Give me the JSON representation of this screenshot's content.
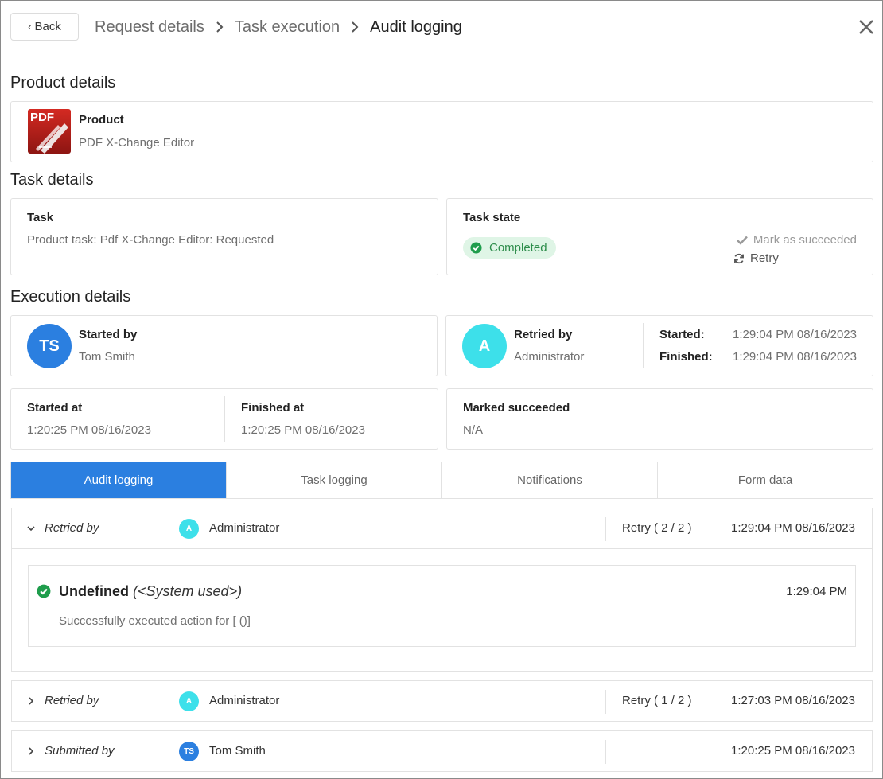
{
  "header": {
    "back_label": "Back",
    "breadcrumbs": [
      "Request details",
      "Task execution",
      "Audit logging"
    ]
  },
  "product_section": {
    "title": "Product details",
    "product_label": "Product",
    "product_name": "PDF X-Change Editor",
    "logo_text": "PDF"
  },
  "task_section": {
    "title": "Task details",
    "task_label": "Task",
    "task_value": "Product task: Pdf X-Change Editor: Requested",
    "state_label": "Task state",
    "state_value": "Completed",
    "mark_succeeded_label": "Mark as succeeded",
    "retry_label": "Retry"
  },
  "execution_section": {
    "title": "Execution details",
    "started_by_label": "Started by",
    "started_by_name": "Tom Smith",
    "started_by_initials": "TS",
    "retried_by_label": "Retried by",
    "retried_by_name": "Administrator",
    "retried_by_initials": "A",
    "started_label": "Started:",
    "started_value": "1:29:04 PM 08/16/2023",
    "finished_label": "Finished:",
    "finished_value": "1:29:04 PM 08/16/2023",
    "started_at_label": "Started at",
    "started_at_value": "1:20:25 PM 08/16/2023",
    "finished_at_label": "Finished at",
    "finished_at_value": "1:20:25 PM 08/16/2023",
    "marked_succeeded_label": "Marked succeeded",
    "marked_succeeded_value": "N/A"
  },
  "tabs": [
    "Audit logging",
    "Task logging",
    "Notifications",
    "Form data"
  ],
  "active_tab": "Audit logging",
  "colors": {
    "accent": "#2b7fe0",
    "success": "#1f9d4c",
    "avatar_ts": "#2b7fe0",
    "avatar_a": "#3de0ea"
  },
  "audit_log": [
    {
      "action": "Retried by",
      "initials": "A",
      "user": "Administrator",
      "retry": "Retry ( 2 / 2 )",
      "timestamp": "1:29:04 PM 08/16/2023",
      "expanded": true,
      "entry": {
        "title": "Undefined",
        "subtitle": "(<System used>)",
        "time": "1:29:04 PM",
        "message": "Successfully executed action for [ ()]"
      }
    },
    {
      "action": "Retried by",
      "initials": "A",
      "user": "Administrator",
      "retry": "Retry ( 1 / 2 )",
      "timestamp": "1:27:03 PM 08/16/2023",
      "expanded": false
    },
    {
      "action": "Submitted by",
      "initials": "TS",
      "user": "Tom Smith",
      "retry": "",
      "timestamp": "1:20:25 PM 08/16/2023",
      "expanded": false
    }
  ]
}
